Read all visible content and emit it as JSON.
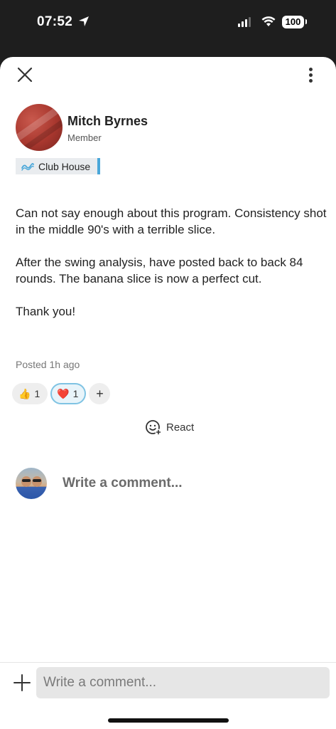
{
  "status_bar": {
    "time": "07:52",
    "battery": "100"
  },
  "post": {
    "author_name": "Mitch Byrnes",
    "author_role": "Member",
    "space_tag": "Club House",
    "paragraphs": [
      "Can not say enough about this program. Consistency shot in the middle 90's with a terrible slice.",
      "After the swing analysis,  have posted back to back 84 rounds. The banana slice is now a perfect cut.",
      "Thank you!"
    ],
    "posted_time": "Posted 1h ago"
  },
  "reactions": [
    {
      "icon": "thumbs-up-icon",
      "emoji": "👍",
      "count": "1",
      "active": false
    },
    {
      "icon": "heart-icon",
      "emoji": "❤️",
      "count": "1",
      "active": true
    }
  ],
  "add_reaction_label": "+",
  "react_label": "React",
  "comment_prompt": "Write a comment...",
  "composer": {
    "placeholder": "Write a comment...",
    "value": ""
  },
  "colors": {
    "status_bar_bg": "#1e1e1e",
    "tag_accent": "#4aa7d9",
    "active_reaction_border": "#7fc3e3"
  }
}
